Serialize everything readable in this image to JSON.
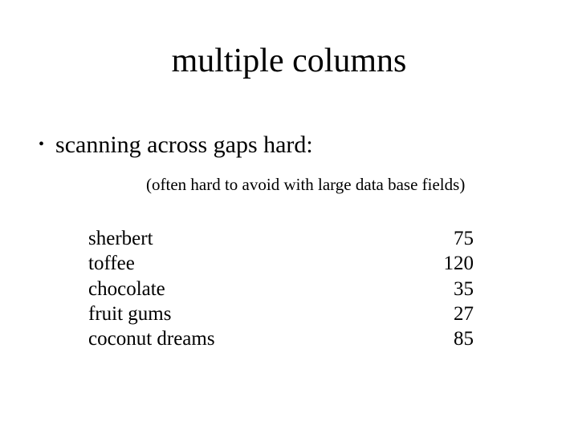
{
  "title": "multiple  columns",
  "bullet": {
    "marker": "•",
    "text": "scanning across gaps hard:"
  },
  "subnote": "(often hard to avoid with large data base fields)",
  "table": {
    "rows": [
      {
        "label": "sherbert",
        "value": "75"
      },
      {
        "label": "toffee",
        "value": "120"
      },
      {
        "label": "chocolate",
        "value": "35"
      },
      {
        "label": "fruit gums",
        "value": "27"
      },
      {
        "label": "coconut dreams",
        "value": "85"
      }
    ]
  }
}
